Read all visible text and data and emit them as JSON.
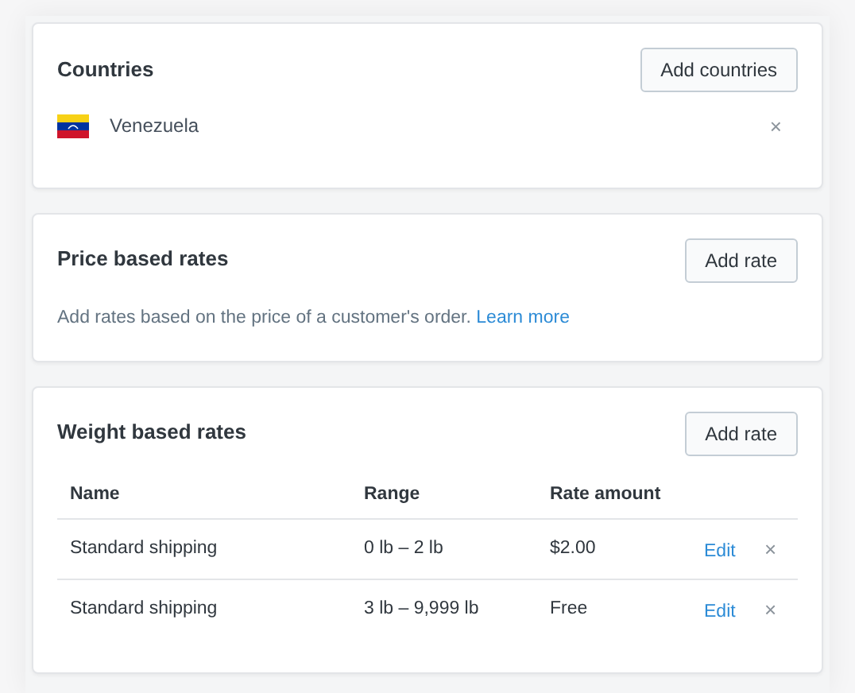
{
  "countries": {
    "title": "Countries",
    "button": "Add countries",
    "items": [
      {
        "name": "Venezuela",
        "remove": "×"
      }
    ]
  },
  "price_rates": {
    "title": "Price based rates",
    "button": "Add rate",
    "description": "Add rates based on the price of a customer's order.",
    "link": "Learn more"
  },
  "weight_rates": {
    "title": "Weight based rates",
    "button": "Add rate",
    "table": {
      "columns": [
        "Name",
        "Range",
        "Rate amount"
      ],
      "rows": [
        {
          "name": "Standard shipping",
          "range": "0 lb – 2 lb",
          "amount": "$2.00",
          "edit": "Edit",
          "remove": "×"
        },
        {
          "name": "Standard shipping",
          "range": "3 lb – 9,999 lb",
          "amount": "Free",
          "edit": "Edit",
          "remove": "×"
        }
      ]
    }
  }
}
